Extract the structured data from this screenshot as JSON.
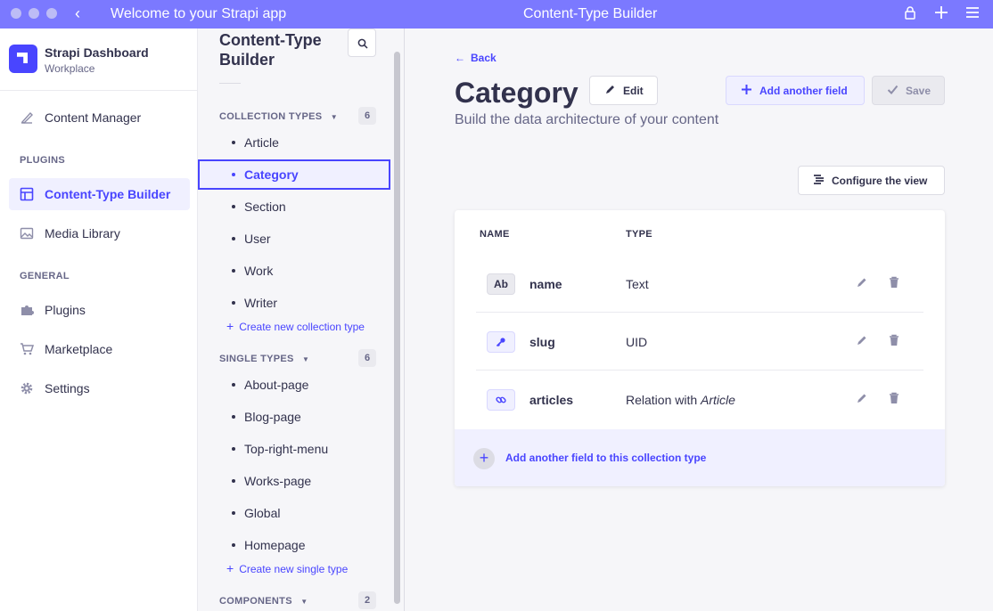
{
  "titlebar": {
    "title": "Welcome to your Strapi app",
    "center": "Content-Type Builder",
    "back_glyph": "‹",
    "icons": [
      "lock-icon",
      "plus-icon",
      "menu-icon"
    ],
    "color": "#7b79ff"
  },
  "brand": {
    "name": "Strapi Dashboard",
    "workspace": "Workplace",
    "color": "#4945ff"
  },
  "nav": {
    "content_manager": "Content Manager",
    "plugins_section": "PLUGINS",
    "content_type_builder": "Content-Type Builder",
    "media_library": "Media Library",
    "general_section": "GENERAL",
    "plugins": "Plugins",
    "marketplace": "Marketplace",
    "settings": "Settings"
  },
  "subnav": {
    "title_line1": "Content-Type",
    "title_line2": "Builder",
    "collection_section": "COLLECTION TYPES",
    "collection_count": "6",
    "collection_items": [
      "Article",
      "Category",
      "Section",
      "User",
      "Work",
      "Writer"
    ],
    "create_collection": "Create new collection type",
    "single_section": "SINGLE TYPES",
    "single_count": "6",
    "single_items": [
      "About-page",
      "Blog-page",
      "Top-right-menu",
      "Works-page",
      "Global",
      "Homepage"
    ],
    "create_single": "Create new single type",
    "components_section": "COMPONENTS",
    "components_count": "2"
  },
  "main": {
    "back": "Back",
    "title": "Category",
    "subtitle": "Build the data architecture of your content",
    "edit": "Edit",
    "add_field": "Add another field",
    "save": "Save",
    "configure": "Configure the view",
    "col_name": "NAME",
    "col_type": "TYPE",
    "fields": [
      {
        "badge": "Ab",
        "name": "name",
        "type": "Text",
        "type_em": ""
      },
      {
        "badge": "",
        "name": "slug",
        "type": "UID",
        "type_em": ""
      },
      {
        "badge": "",
        "name": "articles",
        "type": "Relation with ",
        "type_em": "Article"
      }
    ],
    "add_footer": "Add another field to this collection type"
  },
  "colors": {
    "primary": "#4945ff",
    "primary_light": "#f0f0ff",
    "text": "#32324d",
    "muted": "#666687"
  }
}
